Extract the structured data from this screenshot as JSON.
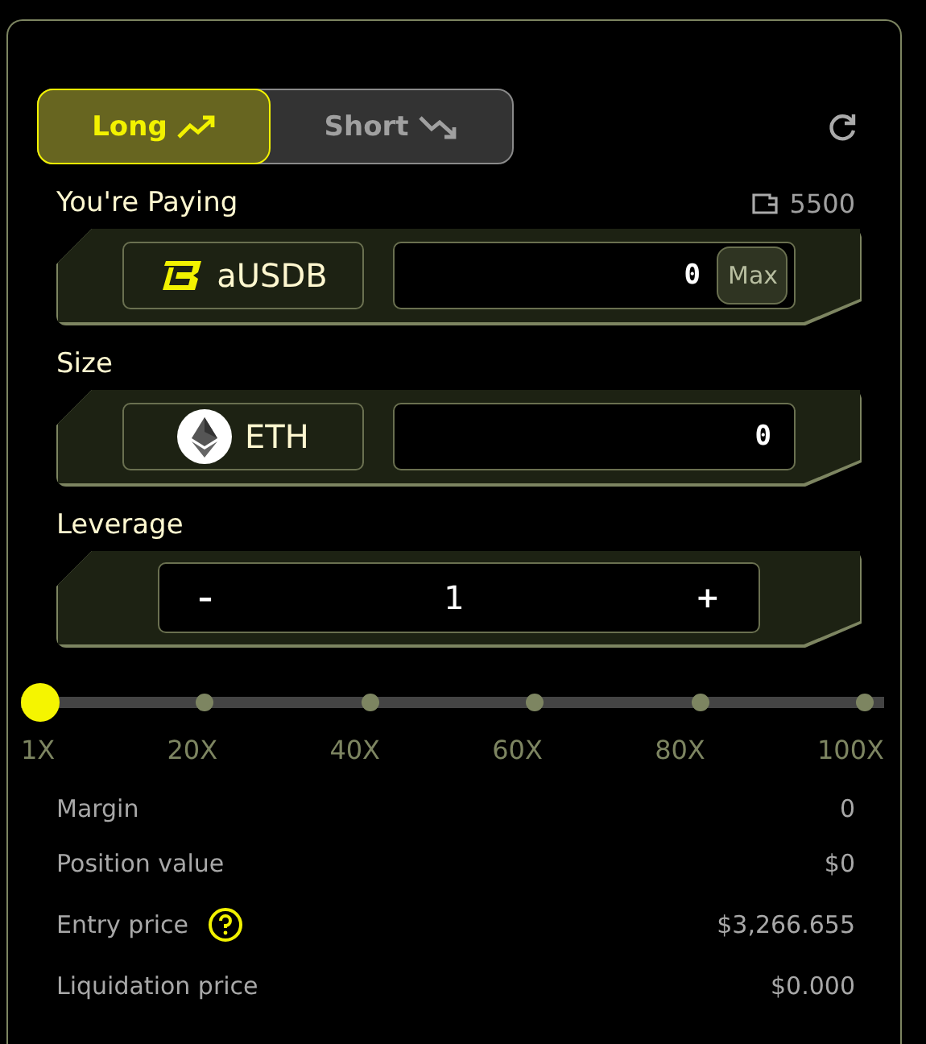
{
  "tabs": [
    {
      "label": "Long",
      "kind": "up",
      "selected": true
    },
    {
      "label": "Short",
      "kind": "down",
      "selected": false
    }
  ],
  "paying": {
    "label": "You're Paying",
    "balance": "5500",
    "token": "aUSDB",
    "value": "0",
    "max": "Max"
  },
  "size": {
    "label": "Size",
    "token": "ETH",
    "value": "0"
  },
  "leverage": {
    "label": "Leverage",
    "minus": "–",
    "value": "1",
    "plus": "+"
  },
  "slider": {
    "level": 0,
    "ticks": [
      "1X",
      "20X",
      "40X",
      "60X",
      "80X",
      "100X"
    ]
  },
  "details": [
    {
      "label": "Margin",
      "value": "0",
      "help": false
    },
    {
      "label": "Position value",
      "value": "$0",
      "help": false
    },
    {
      "label": "Entry price",
      "value": "$3,266.655",
      "help": true
    },
    {
      "label": "Liquidation price",
      "value": "$0.000",
      "help": false
    }
  ]
}
